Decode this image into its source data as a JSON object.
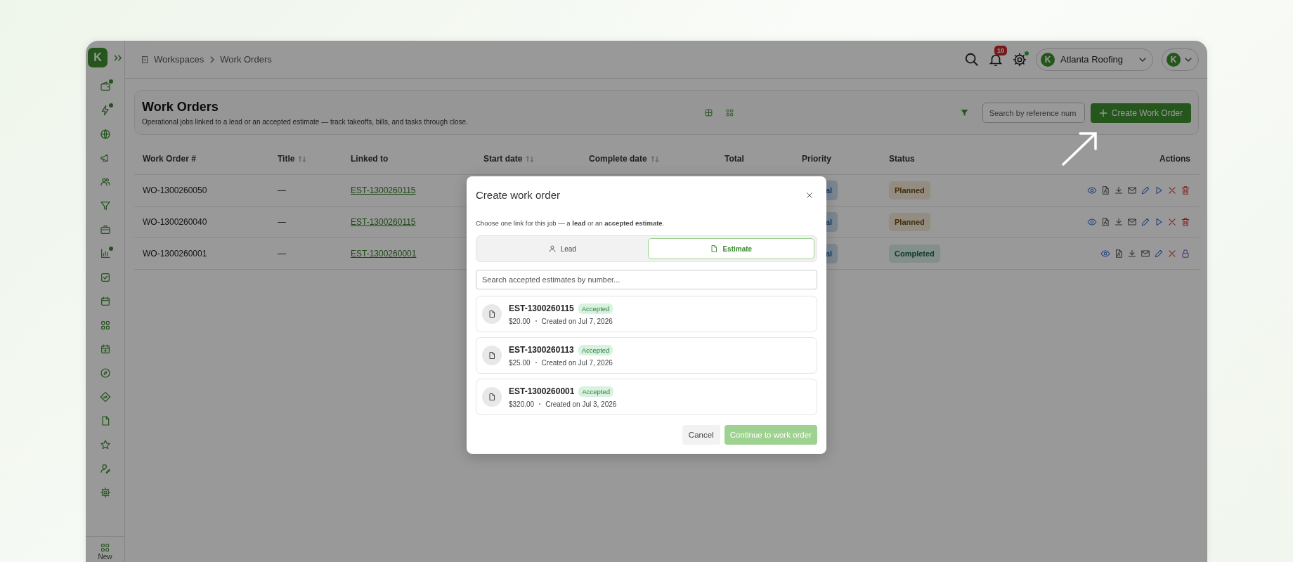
{
  "sidebar": {
    "logo": "K",
    "items": [
      {
        "kind": "wallet",
        "dot": true
      },
      {
        "kind": "bolt",
        "dot": true
      },
      {
        "kind": "globe",
        "dot": false
      },
      {
        "kind": "megaphone",
        "dot": false
      },
      {
        "kind": "users",
        "dot": false
      },
      {
        "kind": "filter",
        "dot": false
      },
      {
        "kind": "briefcase",
        "dot": false
      },
      {
        "kind": "chart",
        "dot": true
      },
      {
        "kind": "checkbox",
        "dot": false
      },
      {
        "kind": "calendar",
        "dot": false
      },
      {
        "kind": "grid",
        "dot": false
      },
      {
        "kind": "calendar-plus",
        "dot": false
      },
      {
        "kind": "compass",
        "dot": false
      },
      {
        "kind": "direction",
        "dot": false
      },
      {
        "kind": "file",
        "dot": false
      },
      {
        "kind": "star",
        "dot": false
      },
      {
        "kind": "user-edit",
        "dot": false
      },
      {
        "kind": "gear",
        "dot": false
      }
    ],
    "footer": "New"
  },
  "breadcrumb": [
    "Workspaces",
    "Work Orders"
  ],
  "header": {
    "notifications": "10",
    "settings_dot": true,
    "company": "Atlanta Roofing",
    "company_logo": "K",
    "avatar": "K"
  },
  "page": {
    "title": "Work Orders",
    "subtitle": "Operational jobs linked to a lead or an accepted estimate — track takeoffs, bills, and tasks through close.",
    "search_placeholder": "Search by reference num",
    "create_button": "Create Work Order"
  },
  "table": {
    "columns": [
      {
        "label": "Work Order #",
        "sortable": false
      },
      {
        "label": "Title",
        "sortable": true
      },
      {
        "label": "Linked to",
        "sortable": false
      },
      {
        "label": "Start date",
        "sortable": true
      },
      {
        "label": "Complete date",
        "sortable": true
      },
      {
        "label": "Total",
        "sortable": false
      },
      {
        "label": "Priority",
        "sortable": false
      },
      {
        "label": "Status",
        "sortable": false
      },
      {
        "label": "Actions",
        "sortable": false
      }
    ],
    "rows": [
      {
        "number": "WO-1300260050",
        "title": "—",
        "linked": "EST-1300260115",
        "priority": "al",
        "status": {
          "label": "Planned",
          "kind": "planned"
        },
        "actions": [
          {
            "kind": "view"
          },
          {
            "kind": "pdf"
          },
          {
            "kind": "download"
          },
          {
            "kind": "mail"
          },
          {
            "kind": "edit"
          },
          {
            "kind": "start"
          },
          {
            "kind": "cancel"
          },
          {
            "kind": "delete"
          }
        ]
      },
      {
        "number": "WO-1300260040",
        "title": "—",
        "linked": "EST-1300260115",
        "priority": "al",
        "status": {
          "label": "Planned",
          "kind": "planned"
        },
        "actions": [
          {
            "kind": "view"
          },
          {
            "kind": "pdf"
          },
          {
            "kind": "download"
          },
          {
            "kind": "mail"
          },
          {
            "kind": "edit"
          },
          {
            "kind": "start"
          },
          {
            "kind": "cancel"
          },
          {
            "kind": "delete"
          }
        ]
      },
      {
        "number": "WO-1300260001",
        "title": "—",
        "linked": "EST-1300260001",
        "priority": "al",
        "status": {
          "label": "Completed",
          "kind": "completed"
        },
        "actions": [
          {
            "kind": "view"
          },
          {
            "kind": "pdf"
          },
          {
            "kind": "download"
          },
          {
            "kind": "mail"
          },
          {
            "kind": "edit"
          },
          {
            "kind": "cancel"
          },
          {
            "kind": "lock"
          }
        ]
      }
    ]
  },
  "modal": {
    "title": "Create work order",
    "intro": "Choose one link for this job — a **lead** or an **accepted estimate**.",
    "tabs": [
      {
        "label": "Lead",
        "kind": "user",
        "selected": false
      },
      {
        "label": "Estimate",
        "kind": "file",
        "selected": true
      }
    ],
    "search_placeholder": "Search accepted estimates by number...",
    "estimates": [
      {
        "number": "EST-1300260115",
        "badge": "Accepted",
        "amount": "$20.00",
        "created": "Created on Jul 7, 2026"
      },
      {
        "number": "EST-1300260113",
        "badge": "Accepted",
        "amount": "$25.00",
        "created": "Created on Jul 7, 2026"
      },
      {
        "number": "EST-1300260001",
        "badge": "Accepted",
        "amount": "$320.00",
        "created": "Created on Jul 3, 2026"
      }
    ],
    "cancel": "Cancel",
    "continue": "Continue to work order",
    "continue_disabled": true
  }
}
